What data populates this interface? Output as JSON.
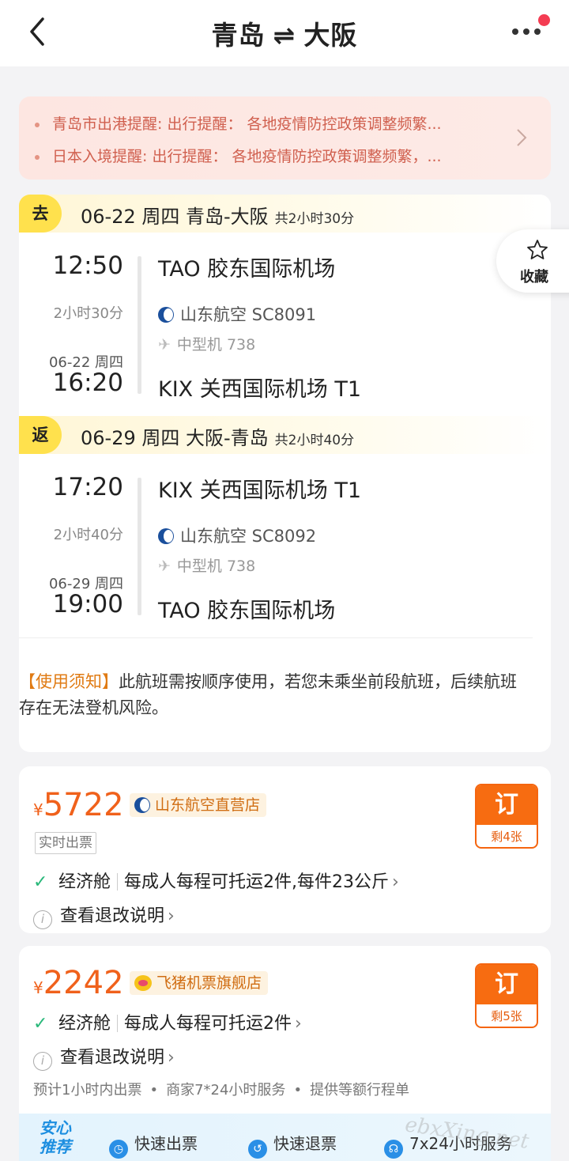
{
  "header": {
    "from": "青岛",
    "swap": "⇌",
    "to": "大阪"
  },
  "notices": [
    "青岛市出港提醒: 出行提醒：  各地疫情防控政策调整频繁...",
    "日本入境提醒: 出行提醒：  各地疫情防控政策调整频繁，..."
  ],
  "favorite": {
    "label": "收藏"
  },
  "segments": [
    {
      "tag": "去",
      "summary": "06-22 周四 青岛-大阪",
      "total": "共2小时30分",
      "dep_time": "12:50",
      "dep_airport": "TAO 胶东国际机场",
      "duration": "2小时30分",
      "airline": "山东航空 SC8091",
      "aircraft": "中型机 738",
      "arr_date": "06-22 周四",
      "arr_time": "16:20",
      "arr_airport": "KIX 关西国际机场 T1"
    },
    {
      "tag": "返",
      "summary": "06-29 周四 大阪-青岛",
      "total": "共2小时40分",
      "dep_time": "17:20",
      "dep_airport": "KIX 关西国际机场 T1",
      "duration": "2小时40分",
      "airline": "山东航空 SC8092",
      "aircraft": "中型机 738",
      "arr_date": "06-29 周四",
      "arr_time": "19:00",
      "arr_airport": "TAO 胶东国际机场"
    }
  ],
  "usage": {
    "label": "【使用须知】",
    "text": "此航班需按顺序使用，若您未乘坐前段航班，后续航班存在无法登机风险。"
  },
  "fares": [
    {
      "currency": "¥",
      "price": "5722",
      "store": "山东航空直营店",
      "realtime": "实时出票",
      "book_label": "订",
      "remaining": "剩4张",
      "cabin": "经济舱",
      "baggage": "每成人每程可托运2件,每件23公斤",
      "refund": "查看退改说明"
    },
    {
      "currency": "¥",
      "price": "2242",
      "store": "飞猪机票旗舰店",
      "book_label": "订",
      "remaining": "剩5张",
      "cabin": "经济舱",
      "baggage": "每成人每程可托运2件",
      "refund": "查看退改说明",
      "services": [
        "预计1小时内出票",
        "商家7*24小时服务",
        "提供等额行程单"
      ],
      "banner": {
        "title": "安心推荐",
        "items": [
          "快速出票",
          "快速退票",
          "7x24小时服务"
        ]
      }
    }
  ],
  "watermark": "ebxXing.net",
  "colors": {
    "accent": "#f0611b",
    "book": "#f76c11",
    "tag": "#ffe14d",
    "check": "#29b87a",
    "notice": "#d05f4e"
  }
}
